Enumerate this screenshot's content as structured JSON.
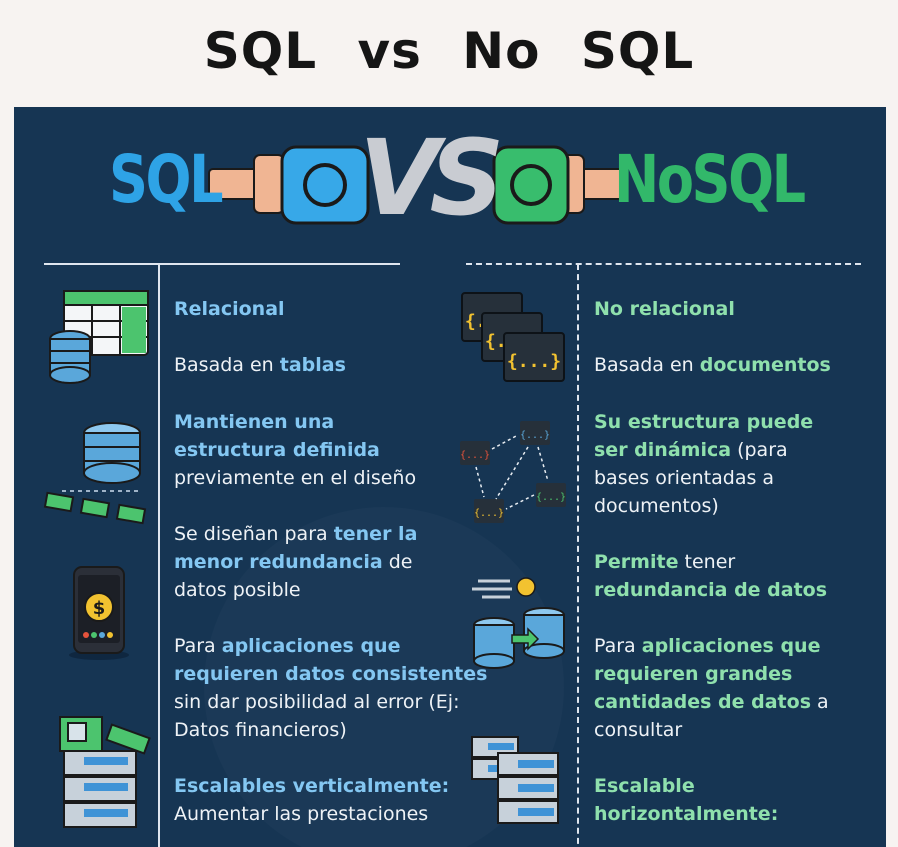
{
  "title": "SQL vs No SQL",
  "hero": {
    "left_label": "SQL",
    "vs_label": "VS",
    "right_label": "NoSQL"
  },
  "sql_items": {
    "relacional": "Relacional",
    "tablas_prefix": "Basada en ",
    "tablas_hl": "tablas",
    "estructura_l1": "Mantienen una",
    "estructura_l2": "estructura definida",
    "estructura_l3": "previamente en el diseño",
    "redundancia_l1_pre": "Se diseñan para ",
    "redundancia_l1_hl": "tener la",
    "redundancia_l2_hl": "menor redundancia",
    "redundancia_l2_post": " de",
    "redundancia_l3": "datos posible",
    "aplicaciones_l1_pre": "Para ",
    "aplicaciones_l1_hl": "aplicaciones que",
    "aplicaciones_l2_hl": "requieren datos consistentes",
    "aplicaciones_l3": "sin dar posibilidad al error (Ej:",
    "aplicaciones_l4": "Datos financieros)",
    "escalables_l1_hl": "Escalables verticalmente:",
    "escalables_l2": "Aumentar las prestaciones"
  },
  "nosql_items": {
    "no_relacional": "No relacional",
    "documentos_prefix": "Basada en ",
    "documentos_hl": "documentos",
    "dinamica_l1_hl": "Su estructura puede",
    "dinamica_l2_hl": "ser dinámica",
    "dinamica_l2_post": " (para",
    "dinamica_l3": "bases orientadas a",
    "dinamica_l4": "documentos)",
    "redundancia_l1_hl": "Permite",
    "redundancia_l1_post": " tener",
    "redundancia_l2_hl": "redundancia de datos",
    "aplicaciones_l1_pre": "Para ",
    "aplicaciones_l1_hl": "aplicaciones que",
    "aplicaciones_l2_hl": "requieren grandes",
    "aplicaciones_l3_hl": "cantidades de datos",
    "aplicaciones_l3_post": " a",
    "aplicaciones_l4": "consultar",
    "escalable_l1_hl": "Escalable",
    "escalable_l2_hl": "horizontalmente:"
  },
  "icon_labels": {
    "doc": "{...}",
    "dollar": "$"
  },
  "colors": {
    "panel": "#163553",
    "sql_blue": "#2ea3e6",
    "nosql_green": "#32b86a",
    "sql_highlight": "#84c7f2",
    "nosql_highlight": "#8fe0ad"
  }
}
